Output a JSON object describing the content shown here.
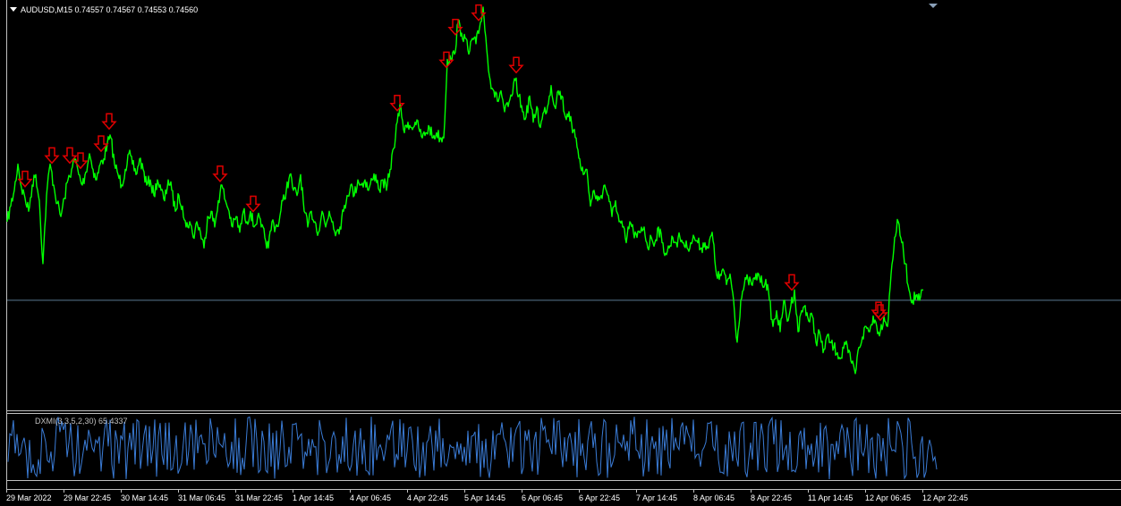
{
  "header": {
    "symbol_line": "AUDUSD,M15  0.74557 0.74567 0.74553 0.74560"
  },
  "indicator": {
    "label": "DXMI(3,3,5,2,30) 65.4337"
  },
  "colors": {
    "background": "#000000",
    "price_line": "#00ff00",
    "indicator_line": "#3a7bd5",
    "arrow": "#e00000",
    "price_level_line": "#5a7890",
    "frame": "#c0c0c0"
  },
  "time_axis": {
    "labels": [
      "29 Mar 2022",
      "29 Mar 22:45",
      "30 Mar 14:45",
      "31 Mar 06:45",
      "31 Mar 22:45",
      "1 Apr 14:45",
      "4 Apr 06:45",
      "4 Apr 22:45",
      "5 Apr 14:45",
      "6 Apr 06:45",
      "6 Apr 22:45",
      "7 Apr 14:45",
      "8 Apr 06:45",
      "8 Apr 22:45",
      "11 Apr 14:45",
      "12 Apr 06:45",
      "12 Apr 22:45"
    ]
  },
  "chart_data": {
    "type": "line",
    "title": "AUDUSD,M15",
    "current_price": 0.7456,
    "bar_quote": {
      "open": 0.74557,
      "high": 0.74567,
      "low": 0.74553,
      "close": 0.7456
    },
    "ylim": [
      0.7415,
      0.757
    ],
    "price_series": {
      "x": [
        0,
        4,
        8,
        12,
        16,
        20,
        24,
        28,
        32,
        36,
        40,
        44,
        48,
        52,
        56,
        60,
        64,
        68,
        72,
        76,
        80,
        84,
        88,
        92,
        96,
        100,
        104,
        108,
        112,
        116,
        120,
        124,
        128,
        132,
        136,
        140,
        144,
        148,
        152,
        156,
        160,
        164,
        168,
        172,
        176,
        180,
        184,
        188,
        192,
        196,
        200,
        204,
        208,
        212,
        216,
        220,
        224,
        228,
        232,
        236,
        240,
        244,
        248,
        252,
        256,
        260,
        264,
        268,
        272,
        276,
        280,
        284,
        288,
        292,
        296,
        300,
        304,
        308,
        312,
        316,
        320,
        324,
        328,
        332,
        336,
        340,
        344,
        348,
        352,
        356,
        360,
        364,
        368,
        372,
        376,
        380,
        384,
        388,
        392,
        396,
        400,
        404,
        408,
        412,
        416,
        420,
        424,
        428,
        432,
        436,
        440,
        444,
        448,
        452,
        456,
        460,
        464,
        468,
        472,
        476,
        480,
        484,
        488,
        492,
        496,
        500,
        504,
        508,
        512,
        516,
        520,
        524,
        528,
        532,
        536,
        540,
        544,
        548,
        552,
        556,
        560,
        564,
        568,
        572,
        576,
        580,
        584,
        588,
        592,
        596,
        600,
        604,
        608,
        612,
        616,
        620,
        624,
        628,
        632,
        636,
        640,
        644,
        648,
        652,
        656,
        660,
        664,
        668,
        672,
        676,
        680,
        684,
        688,
        692,
        696,
        700,
        704,
        708,
        712,
        716,
        720,
        724,
        728,
        732,
        736,
        740,
        744,
        748,
        752,
        756,
        760,
        764,
        768,
        772,
        776,
        780,
        784,
        788,
        792,
        796,
        800,
        804,
        808,
        812,
        816,
        820,
        824,
        828,
        832,
        836,
        840,
        844,
        848,
        852,
        856,
        860,
        864,
        868,
        872,
        876,
        880,
        884,
        888,
        892,
        896,
        900,
        904,
        908,
        912,
        916,
        920,
        924,
        928,
        932,
        936,
        940,
        944,
        948,
        952,
        956,
        960,
        964,
        968,
        972,
        976,
        980,
        984,
        988,
        992,
        996,
        1000,
        1004,
        1008,
        1012,
        1016,
        1020,
        1024,
        1028,
        1032,
        1036,
        1040
      ],
      "y": [
        0.7486,
        0.7492,
        0.7498,
        0.7508,
        0.7499,
        0.7495,
        0.749,
        0.75,
        0.7504,
        0.7494,
        0.747,
        0.7496,
        0.7508,
        0.75,
        0.7493,
        0.7488,
        0.7495,
        0.7502,
        0.7506,
        0.751,
        0.7504,
        0.75,
        0.7505,
        0.7512,
        0.7506,
        0.7502,
        0.7508,
        0.751,
        0.7516,
        0.7518,
        0.7508,
        0.7504,
        0.75,
        0.7506,
        0.7512,
        0.7508,
        0.7504,
        0.751,
        0.7506,
        0.75,
        0.7502,
        0.7496,
        0.7502,
        0.7498,
        0.7494,
        0.7502,
        0.7498,
        0.749,
        0.7496,
        0.7492,
        0.7484,
        0.7486,
        0.748,
        0.7486,
        0.7482,
        0.7476,
        0.7488,
        0.749,
        0.7484,
        0.7494,
        0.75,
        0.7494,
        0.749,
        0.7484,
        0.7488,
        0.7482,
        0.749,
        0.7486,
        0.749,
        0.7484,
        0.7488,
        0.7484,
        0.748,
        0.7476,
        0.7486,
        0.7484,
        0.7486,
        0.7494,
        0.7498,
        0.7504,
        0.7498,
        0.7496,
        0.7504,
        0.749,
        0.7484,
        0.749,
        0.7486,
        0.7482,
        0.749,
        0.7484,
        0.749,
        0.7486,
        0.7482,
        0.7484,
        0.749,
        0.7496,
        0.75,
        0.7496,
        0.7502,
        0.75,
        0.7502,
        0.7498,
        0.7502,
        0.7504,
        0.7498,
        0.7502,
        0.7498,
        0.7506,
        0.7514,
        0.7524,
        0.753,
        0.752,
        0.7524,
        0.7522,
        0.7524,
        0.7522,
        0.7518,
        0.752,
        0.7522,
        0.7518,
        0.752,
        0.7518,
        0.7518,
        0.7548,
        0.7548,
        0.755,
        0.7562,
        0.7558,
        0.7556,
        0.755,
        0.7556,
        0.7554,
        0.756,
        0.7568,
        0.7552,
        0.754,
        0.7536,
        0.7532,
        0.7536,
        0.7528,
        0.753,
        0.7534,
        0.754,
        0.7534,
        0.7528,
        0.7526,
        0.7534,
        0.7524,
        0.753,
        0.7522,
        0.7528,
        0.753,
        0.7538,
        0.753,
        0.7536,
        0.7534,
        0.7526,
        0.7528,
        0.752,
        0.7518,
        0.751,
        0.7504,
        0.7506,
        0.7492,
        0.7498,
        0.7494,
        0.7496,
        0.75,
        0.7496,
        0.7488,
        0.7494,
        0.7486,
        0.7484,
        0.7478,
        0.7486,
        0.7482,
        0.748,
        0.7482,
        0.7484,
        0.7476,
        0.748,
        0.7478,
        0.7484,
        0.7478,
        0.7474,
        0.7476,
        0.748,
        0.7478,
        0.748,
        0.7478,
        0.7476,
        0.7478,
        0.748,
        0.7478,
        0.7476,
        0.7478,
        0.7476,
        0.7482,
        0.7468,
        0.7464,
        0.7468,
        0.7462,
        0.7466,
        0.7456,
        0.744,
        0.7456,
        0.7462,
        0.7464,
        0.7462,
        0.7464,
        0.7466,
        0.7462,
        0.7464,
        0.7456,
        0.7446,
        0.7452,
        0.7444,
        0.7456,
        0.7448,
        0.7454,
        0.746,
        0.7444,
        0.7452,
        0.7454,
        0.7448,
        0.745,
        0.744,
        0.7444,
        0.7436,
        0.7442,
        0.744,
        0.7438,
        0.7436,
        0.7434,
        0.744,
        0.7436,
        0.7432,
        0.7428,
        0.7438,
        0.7442,
        0.7446,
        0.7444,
        0.745,
        0.7446,
        0.7444,
        0.745,
        0.7446,
        0.7466,
        0.748,
        0.7486,
        0.7478,
        0.747,
        0.746,
        0.7456,
        0.7458,
        0.7456,
        0.746
      ]
    },
    "sell_arrows_x": [
      20,
      50,
      70,
      82,
      105,
      114,
      238,
      275,
      436,
      491,
      501,
      527,
      569,
      877,
      974,
      976
    ],
    "indicator_series": {
      "name": "DXMI(3,3,5,2,30)",
      "last_value": 65.4337,
      "ylim": [
        0,
        100
      ]
    }
  }
}
